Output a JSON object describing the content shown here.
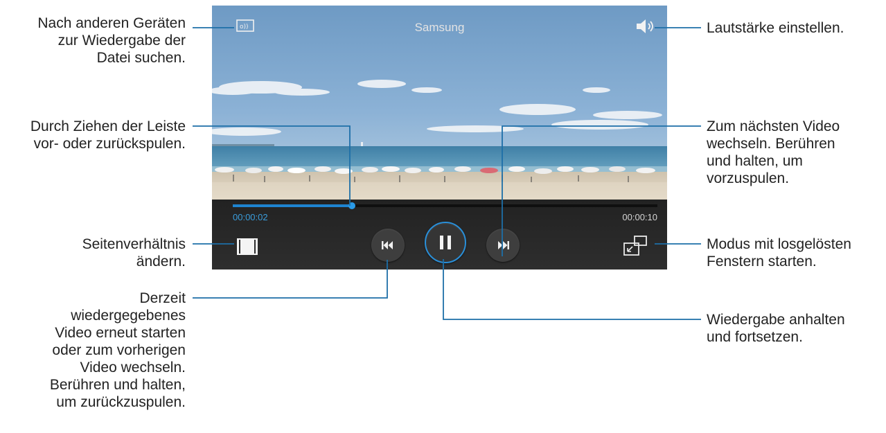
{
  "player": {
    "title": "Samsung",
    "current_time": "00:00:02",
    "total_time": "00:00:10",
    "progress": 0.28,
    "accent_color": "#1e84d0"
  },
  "icons": {
    "cast": "cast-devices-icon",
    "volume": "volume-icon",
    "aspect_ratio": "aspect-ratio-icon",
    "previous": "skip-previous-icon",
    "pause": "pause-icon",
    "next": "skip-next-icon",
    "popup": "popup-window-icon"
  },
  "callouts": {
    "search_devices": [
      "Nach anderen Geräten",
      "zur Wiedergabe der",
      "Datei suchen."
    ],
    "seek_bar": [
      "Durch Ziehen der Leiste",
      "vor- oder zurückspulen."
    ],
    "aspect_ratio": [
      "Seitenverhältnis",
      "ändern."
    ],
    "previous": [
      "Derzeit",
      "wiedergegebenes",
      "Video erneut starten",
      "oder zum vorherigen",
      "Video wechseln.",
      "Berühren und halten,",
      "um zurückzuspulen."
    ],
    "volume": [
      "Lautstärke einstellen."
    ],
    "next": [
      "Zum nächsten Video",
      "wechseln. Berühren",
      "und halten, um",
      "vorzuspulen."
    ],
    "popup": [
      "Modus mit losgelösten",
      "Fenstern starten."
    ],
    "pause": [
      "Wiedergabe anhalten",
      "und fortsetzen."
    ]
  },
  "line_color": "#1d6fa8"
}
